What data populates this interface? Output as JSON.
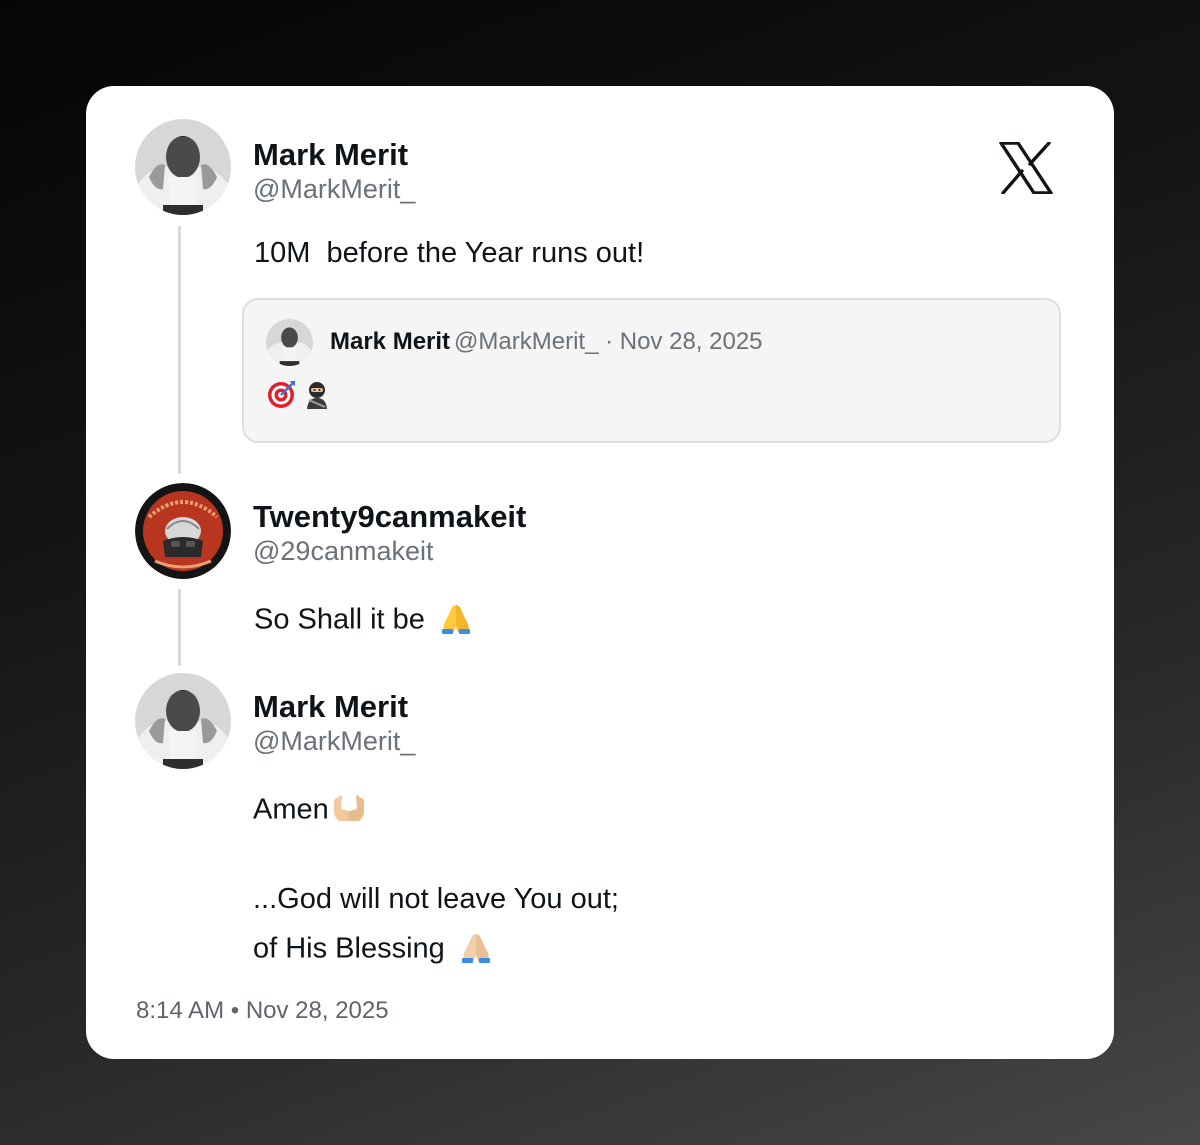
{
  "brand": {
    "icon": "x-logo-icon",
    "color": "#0f1419"
  },
  "thread": [
    {
      "author_name": "Mark Merit",
      "author_handle": "@MarkMerit_",
      "text": "10M  before the Year runs out!",
      "quote": {
        "author_name": "Mark Merit",
        "author_handle": "@MarkMerit_",
        "separator": " · ",
        "date": "Nov 28, 2025",
        "emojis": [
          "direct-hit-emoji",
          "ninja-emoji"
        ]
      }
    },
    {
      "author_name": "Twenty9canmakeit",
      "author_handle": "@29canmakeit",
      "text": "So Shall it be",
      "emoji": "folded-hands-emoji"
    },
    {
      "author_name": "Mark Merit",
      "author_handle": "@MarkMerit_",
      "lines": [
        "Amen",
        "...God will not leave You out;",
        "of His Blessing"
      ],
      "emojis": [
        "palms-up-together-emoji",
        "folded-hands-emoji"
      ]
    }
  ],
  "footer": {
    "time": "8:14 AM",
    "separator": " • ",
    "date": "Nov 28, 2025"
  }
}
